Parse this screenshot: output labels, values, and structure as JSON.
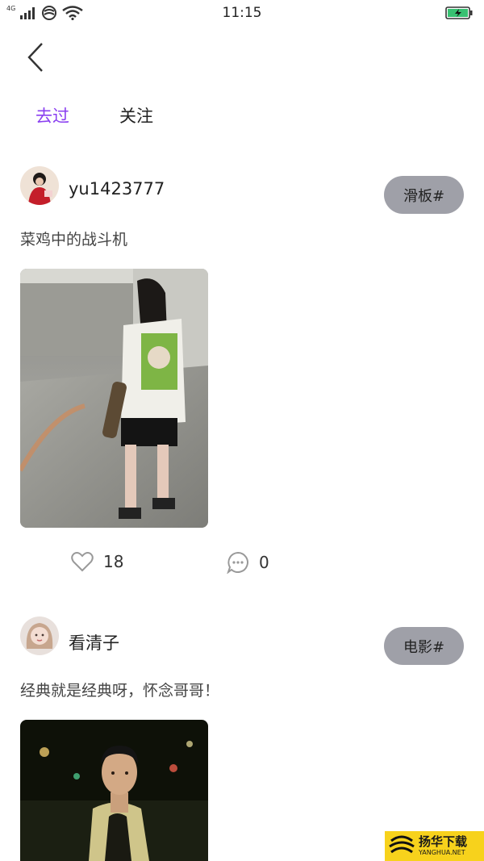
{
  "status_bar": {
    "network": "4G",
    "time": "11:15"
  },
  "tabs": [
    {
      "label": "去过",
      "active": true
    },
    {
      "label": "关注",
      "active": false
    }
  ],
  "posts": [
    {
      "username": "yu1423777",
      "tag": "滑板#",
      "text": "菜鸡中的战斗机",
      "likes": "18",
      "comments": "0"
    },
    {
      "username": "看清子",
      "tag": "电影#",
      "text": "经典就是经典呀，怀念哥哥！"
    }
  ],
  "watermark": {
    "cn": "扬华下载",
    "en": "YANGHUA.NET"
  },
  "colors": {
    "accent": "#8a3ff0",
    "tag_bg": "#9fa0a8",
    "watermark_bg": "#f7d21c"
  }
}
